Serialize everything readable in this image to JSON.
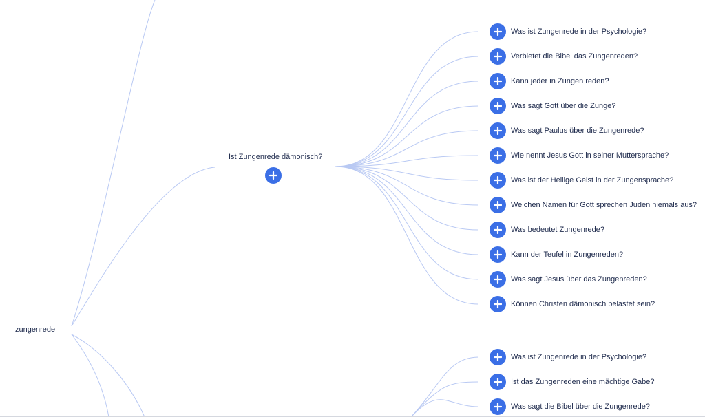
{
  "mindmap": {
    "root_label": "zungenrede",
    "branch": {
      "label": "Ist Zungenrede dämonisch?",
      "children": [
        "Was ist Zungenrede in der Psychologie?",
        "Verbietet die Bibel das Zungenreden?",
        "Kann jeder in Zungen reden?",
        "Was sagt Gott über die Zunge?",
        "Was sagt Paulus über die Zungenrede?",
        "Wie nennt Jesus Gott in seiner Muttersprache?",
        "Was ist der Heilige Geist in der Zungensprache?",
        "Welchen Namen für Gott sprechen Juden niemals aus?",
        "Was bedeutet Zungenrede?",
        "Kann der Teufel in Zungenreden?",
        "Was sagt Jesus über das Zungenreden?",
        "Können Christen dämonisch belastet sein?"
      ]
    },
    "lower_children": [
      "Was ist Zungenrede in der Psychologie?",
      "Ist das Zungenreden eine mächtige Gabe?",
      "Was sagt die Bibel über die Zungenrede?"
    ]
  },
  "colors": {
    "accent": "#3b6fe6",
    "edge": "#b9c9f3",
    "text": "#1f2b4d"
  },
  "icons": {
    "expand": "plus-icon"
  }
}
